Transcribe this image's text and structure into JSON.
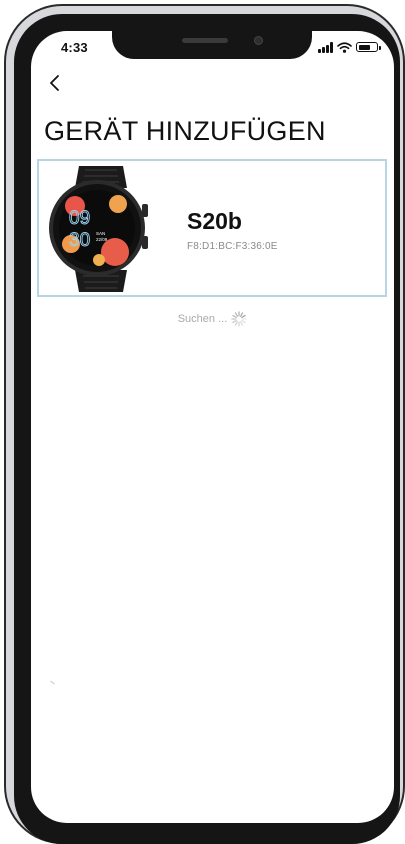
{
  "status_bar": {
    "time": "4:33",
    "signal_icon": "cellular-signal-icon",
    "wifi_icon": "wifi-icon",
    "battery_icon": "battery-icon",
    "battery_level": 0.7
  },
  "header": {
    "back_icon": "chevron-left-icon",
    "title": "GERÄT HINZUFÜGEN"
  },
  "device": {
    "name": "S20b",
    "mac": "F8:D1:BC:F3:36:0E",
    "image_icon": "smartwatch-image",
    "watch_face": {
      "digits_top": "09",
      "digits_bottom": "30",
      "day": "SAN",
      "date": "22/09"
    }
  },
  "search": {
    "label": "Suchen ...",
    "spinner_icon": "loading-spinner-icon"
  },
  "colors": {
    "card_border": "#b7d5e3",
    "text_primary": "#111111",
    "text_secondary": "#8a8a8a",
    "search_text": "#aaaaaa"
  }
}
